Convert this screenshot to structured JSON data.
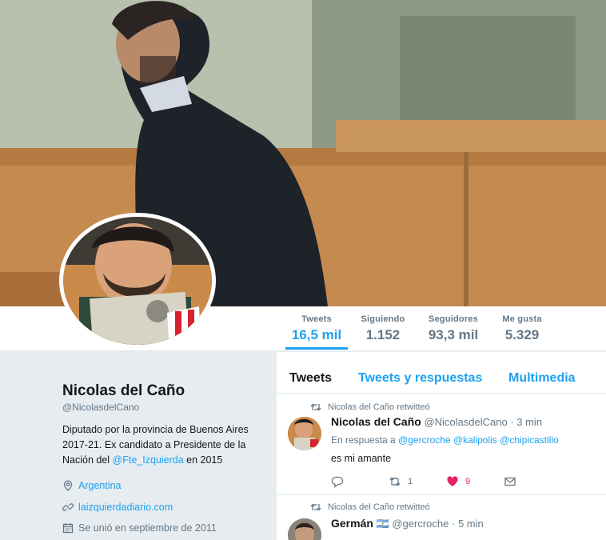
{
  "profile": {
    "name": "Nicolas del Caño",
    "handle": "@NicolasdelCano",
    "bio_text": "Diputado por la provincia de Buenos Aires 2017-21. Ex candidato a Presidente de la Nación del ",
    "bio_link": "@Fte_Izquierda",
    "bio_tail": " en 2015",
    "location": "Argentina",
    "website": "laizquierdadiario.com",
    "joined": "Se unió en septiembre de 2011"
  },
  "stats": [
    {
      "label": "Tweets",
      "value": "16,5 mil"
    },
    {
      "label": "Siguiendo",
      "value": "1.152"
    },
    {
      "label": "Seguidores",
      "value": "93,3 mil"
    },
    {
      "label": "Me gusta",
      "value": "5.329"
    }
  ],
  "tabs": [
    "Tweets",
    "Tweets y respuestas",
    "Multimedia"
  ],
  "tweets": [
    {
      "retweet_label": "Nicolas del Caño retwitteó",
      "author": "Nicolas del Caño",
      "handle": "@NicolasdelCano",
      "time": "· 3 min",
      "reply_prefix": "En respuesta a",
      "reply_to": "@gercroche @kalipolis @chipicastillo",
      "text": "es mi amante",
      "retweets": "1",
      "likes": "9"
    },
    {
      "retweet_label": "Nicolas del Caño retwitteó",
      "author": "Germán",
      "flag": "🇦🇷",
      "handle": "@gercroche",
      "time": "· 5 min"
    }
  ],
  "icons": {
    "location": "location-pin-icon",
    "website": "link-icon",
    "joined": "calendar-icon",
    "retweet": "retweet-icon",
    "reply": "reply-icon",
    "like": "heart-icon",
    "message": "direct-message-icon"
  },
  "colors": {
    "accent": "#1da1f2",
    "like": "#e0245e",
    "text": "#14171a",
    "muted": "#657786"
  }
}
